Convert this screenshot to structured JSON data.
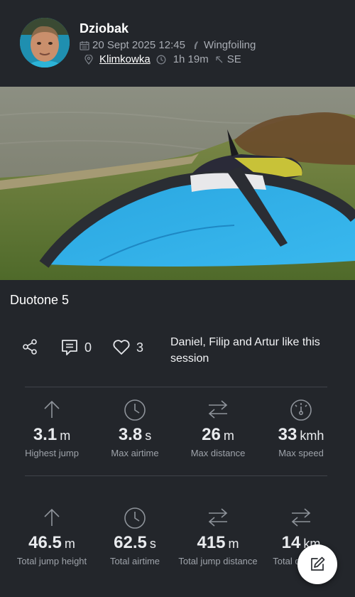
{
  "user": {
    "name": "Dziobak"
  },
  "session": {
    "date": "20 Sept 2025 12:45",
    "sport": "Wingfoiling",
    "location": "Klimkowka",
    "duration": "1h 19m",
    "wind_direction": "SE",
    "title": "Duotone 5"
  },
  "social": {
    "comments_count": "0",
    "likes_count": "3",
    "likes_text": "Daniel, Filip and Artur like this session"
  },
  "stats_primary": [
    {
      "value": "3.1",
      "unit": "m",
      "label": "Highest jump",
      "icon": "arrow-up-icon"
    },
    {
      "value": "3.8",
      "unit": "s",
      "label": "Max airtime",
      "icon": "clock-icon"
    },
    {
      "value": "26",
      "unit": "m",
      "label": "Max distance",
      "icon": "transfer-arrows-icon"
    },
    {
      "value": "33",
      "unit": "kmh",
      "label": "Max speed",
      "icon": "speedometer-icon"
    }
  ],
  "stats_totals": [
    {
      "value": "46.5",
      "unit": "m",
      "label": "Total jump height",
      "icon": "arrow-up-icon"
    },
    {
      "value": "62.5",
      "unit": "s",
      "label": "Total airtime",
      "icon": "clock-icon"
    },
    {
      "value": "415",
      "unit": "m",
      "label": "Total jump distance",
      "icon": "transfer-arrows-icon"
    },
    {
      "value": "14",
      "unit": "km",
      "label": "Total distance",
      "icon": "transfer-arrows-icon"
    }
  ],
  "colors": {
    "background": "#23262b",
    "muted_text": "#a8acb3",
    "fab_background": "#ffffff"
  }
}
